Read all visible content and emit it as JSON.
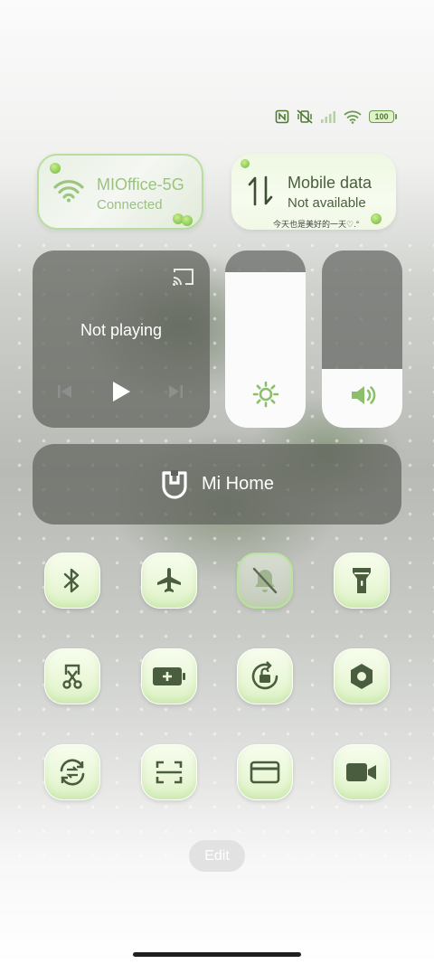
{
  "status_bar": {
    "icons": [
      "nfc-icon",
      "vibrate-silent-icon",
      "signal-icon",
      "wifi-icon"
    ],
    "battery": "100"
  },
  "wifi_card": {
    "network": "MIOffice-5G",
    "status": "Connected",
    "icon": "wifi-icon"
  },
  "mobile_card": {
    "title": "Mobile data",
    "status": "Not available",
    "caption": "今天也是美好的一天♡.°",
    "icon": "data-arrows-icon"
  },
  "media": {
    "title": "Not playing",
    "icons": [
      "cast-icon",
      "previous-icon",
      "play-icon",
      "next-icon"
    ]
  },
  "brightness": {
    "level_percent": 88,
    "icon": "sun-icon"
  },
  "volume": {
    "level_percent": 33,
    "icon": "speaker-icon"
  },
  "mi_home": {
    "label": "Mi Home",
    "icon": "mi-home-icon"
  },
  "toggles": [
    {
      "name": "bluetooth",
      "icon": "bluetooth-icon",
      "active": false
    },
    {
      "name": "airplane-mode",
      "icon": "airplane-icon",
      "active": false
    },
    {
      "name": "silent-mode",
      "icon": "bell-off-icon",
      "active": true
    },
    {
      "name": "flashlight",
      "icon": "flashlight-icon",
      "active": false
    },
    {
      "name": "screenshot",
      "icon": "scissors-icon",
      "active": false
    },
    {
      "name": "battery-saver",
      "icon": "battery-plus-icon",
      "active": false
    },
    {
      "name": "rotation-lock",
      "icon": "rotation-lock-icon",
      "active": false
    },
    {
      "name": "settings",
      "icon": "hexagon-icon",
      "active": false
    },
    {
      "name": "sync",
      "icon": "sync-icon",
      "active": false
    },
    {
      "name": "scanner",
      "icon": "scan-icon",
      "active": false
    },
    {
      "name": "card",
      "icon": "card-icon",
      "active": false
    },
    {
      "name": "screen-recorder",
      "icon": "video-icon",
      "active": false
    }
  ],
  "colors": {
    "accent_green": "#b7dea0",
    "icon_dark_green": "#4a5d3f",
    "panel_gray": "#5f625c"
  },
  "edit_label": "Edit"
}
